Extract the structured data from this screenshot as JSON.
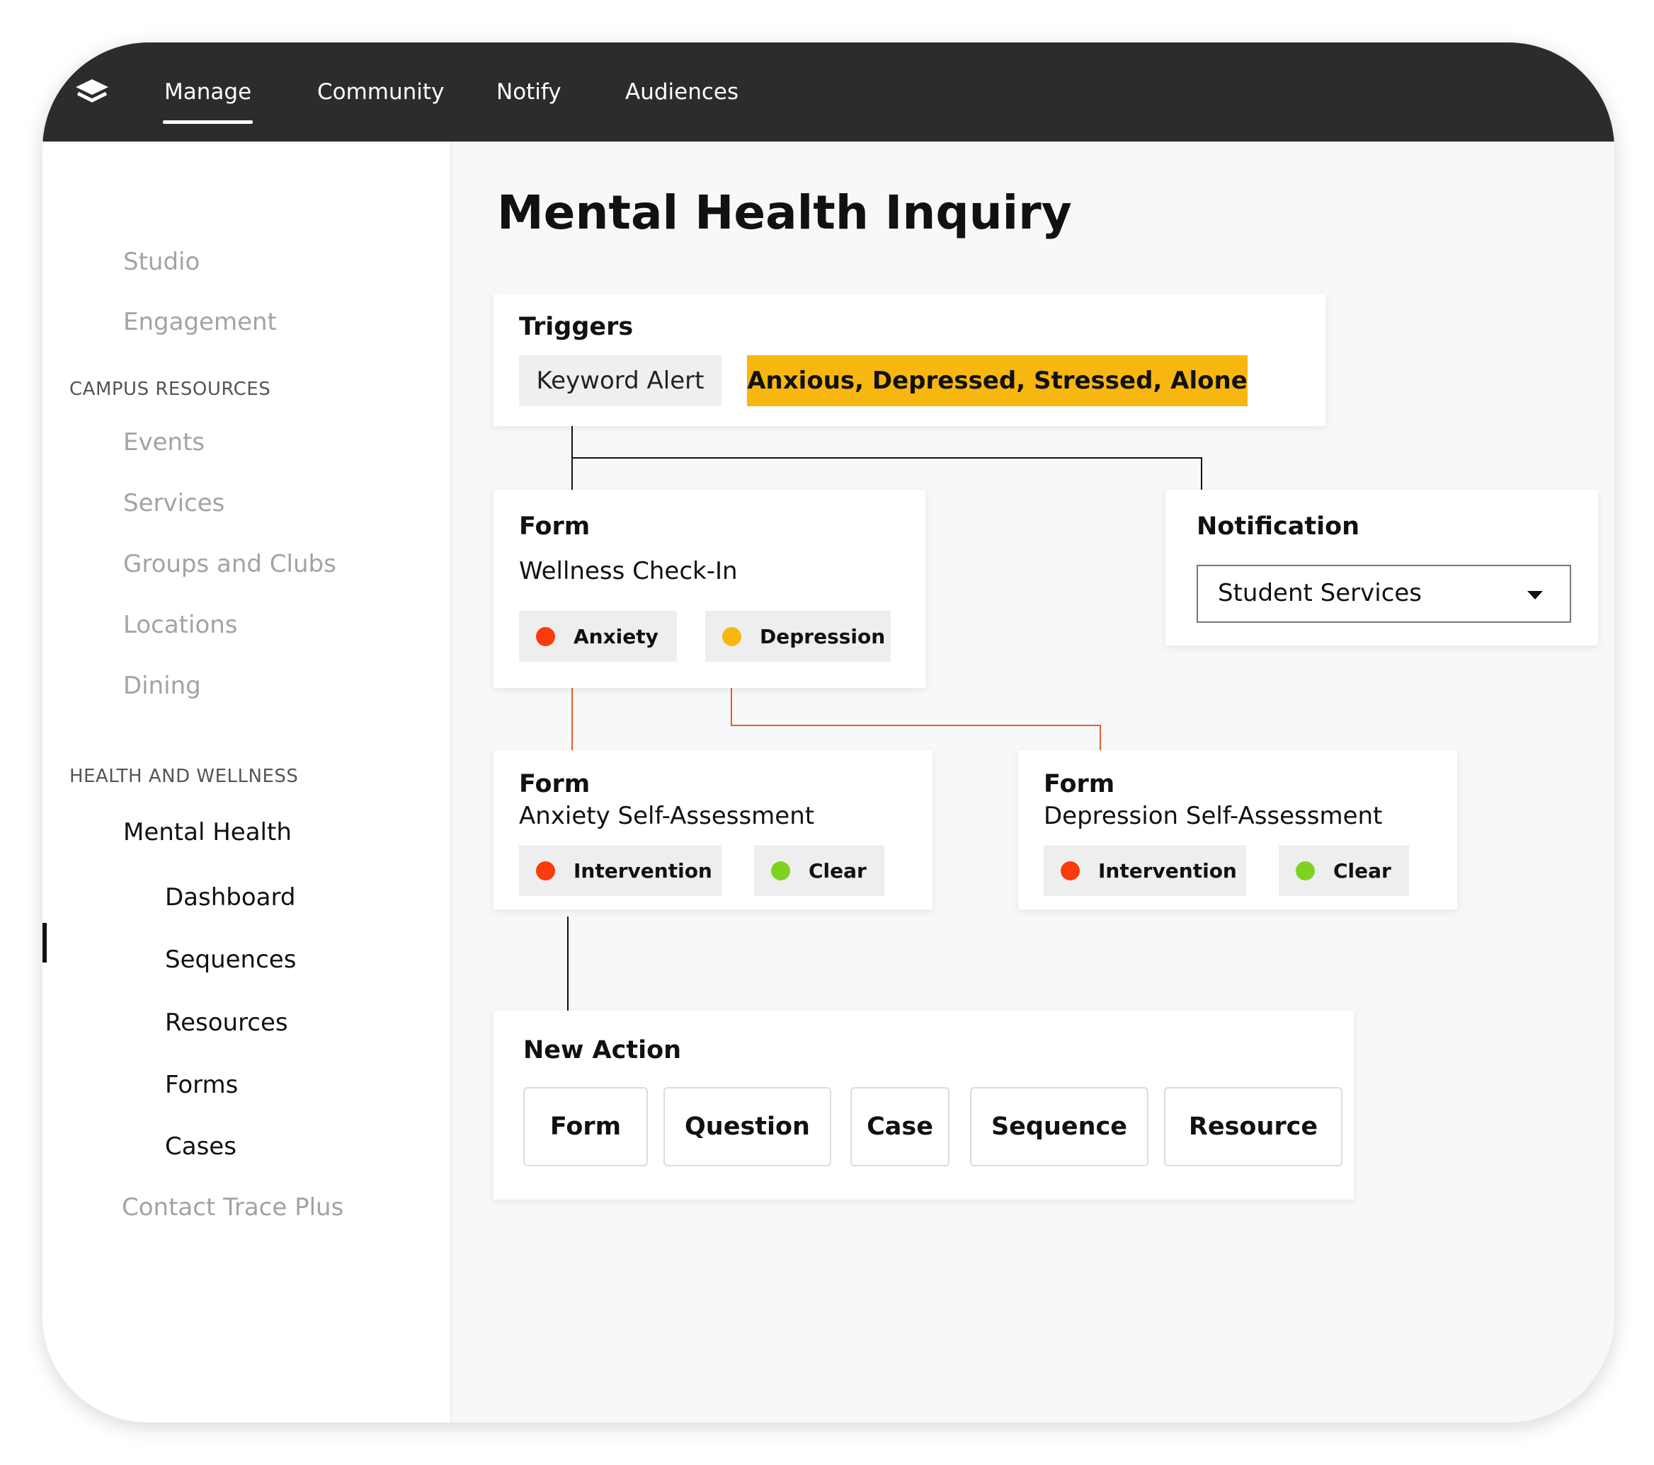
{
  "topnav": {
    "items": [
      {
        "label": "Manage",
        "active": true
      },
      {
        "label": "Community"
      },
      {
        "label": "Notify"
      },
      {
        "label": "Audiences"
      }
    ]
  },
  "sidebar": {
    "top_items": [
      "Studio",
      "Engagement"
    ],
    "campus_heading": "CAMPUS RESOURCES",
    "campus_items": [
      "Events",
      "Services",
      "Groups and Clubs",
      "Locations",
      "Dining"
    ],
    "health_heading": "HEALTH AND WELLNESS",
    "mental_health": "Mental Health",
    "mental_sub": [
      "Dashboard",
      "Sequences",
      "Resources",
      "Forms",
      "Cases"
    ],
    "active_sub": "Sequences",
    "contact_trace": "Contact Trace Plus"
  },
  "page": {
    "title": "Mental Health Inquiry"
  },
  "triggers": {
    "title": "Triggers",
    "type": "Keyword Alert",
    "keywords": "Anxious, Depressed, Stressed, Alone"
  },
  "form_wellness": {
    "title": "Form",
    "name": "Wellness Check-In",
    "chips": [
      {
        "label": "Anxiety",
        "color": "#fa3b0a"
      },
      {
        "label": "Depression",
        "color": "#f8b710"
      }
    ]
  },
  "notification": {
    "title": "Notification",
    "selected": "Student Services"
  },
  "form_anxiety": {
    "title": "Form",
    "name": "Anxiety Self-Assessment",
    "chips": [
      {
        "label": "Intervention",
        "color": "#fa3b0a"
      },
      {
        "label": "Clear",
        "color": "#7ed321"
      }
    ]
  },
  "form_depression": {
    "title": "Form",
    "name": "Depression Self-Assessment",
    "chips": [
      {
        "label": "Intervention",
        "color": "#fa3b0a"
      },
      {
        "label": "Clear",
        "color": "#7ed321"
      }
    ]
  },
  "new_action": {
    "title": "New Action",
    "buttons": [
      "Form",
      "Question",
      "Case",
      "Sequence",
      "Resource"
    ]
  },
  "colors": {
    "topbar": "#2c2c2c",
    "highlight": "#f8b710",
    "connector_dark": "#111111",
    "connector_orange": "#f05a28"
  }
}
